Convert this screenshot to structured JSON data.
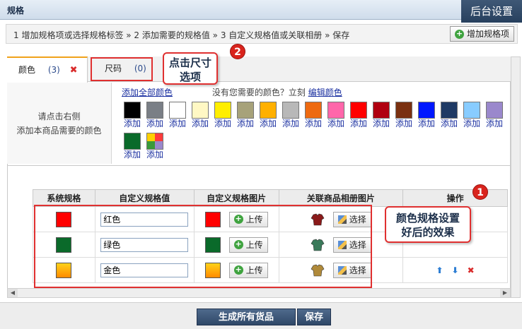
{
  "header": {
    "title": "规格",
    "admin_tab": "后台设置"
  },
  "steps": {
    "text": "1 增加规格项或选择规格标签  » 2 添加需要的规格值  » 3 自定义规格值或关联相册  » 保存",
    "add_button": "增加规格项"
  },
  "tabs": [
    {
      "label": "颜色",
      "count": "(3)"
    },
    {
      "label": "尺码",
      "count": "(0)"
    }
  ],
  "left_note": [
    "请点击右侧",
    "添加本商品需要的颜色"
  ],
  "color_links": {
    "add_all": "添加全部颜色",
    "question": "没有您需要的颜色？立刻",
    "edit": "编辑颜色"
  },
  "swatch_label": "添加",
  "swatches": [
    {
      "color": "#000000"
    },
    {
      "color": "#7a7f86"
    },
    {
      "color": "#ffffff"
    },
    {
      "color": "#fff8c4"
    },
    {
      "color": "#ffee00"
    },
    {
      "color": "#a7a27a"
    },
    {
      "color": "#ffb000"
    },
    {
      "color": "#b8b8b8"
    },
    {
      "color": "#ee6a10"
    },
    {
      "color": "#ff66aa"
    },
    {
      "color": "#ff0000"
    },
    {
      "color": "#b00010"
    },
    {
      "color": "#7a3010"
    },
    {
      "color": "#0018ff"
    },
    {
      "color": "#1f3a64"
    },
    {
      "color": "#88ccff"
    },
    {
      "color": "#9a88cc"
    },
    {
      "color": "#0a6a2a"
    },
    {
      "color": "multi"
    }
  ],
  "table": {
    "headers": [
      "系统规格",
      "自定义规格值",
      "自定义规格图片",
      "关联商品相册图片",
      "操作"
    ],
    "upload_label": "上传",
    "select_label": "选择",
    "rows": [
      {
        "color": "#ff0000",
        "value": "红色",
        "img": "#ff0000",
        "garment": "#8a1a1a"
      },
      {
        "color": "#0a6a2a",
        "value": "绿色",
        "img": "#0a6a2a",
        "garment": "#3a7a5a"
      },
      {
        "color": "gradient",
        "value": "金色",
        "img": "gradient",
        "garment": "#b08a3a"
      }
    ]
  },
  "callouts": {
    "size_tip": [
      "点击尺寸",
      "选项"
    ],
    "effect_tip": [
      "颜色规格设置",
      "好后的效果"
    ],
    "badge1": "1",
    "badge2": "2"
  },
  "bottom": {
    "generate": "生成所有货品",
    "save": "保存"
  }
}
